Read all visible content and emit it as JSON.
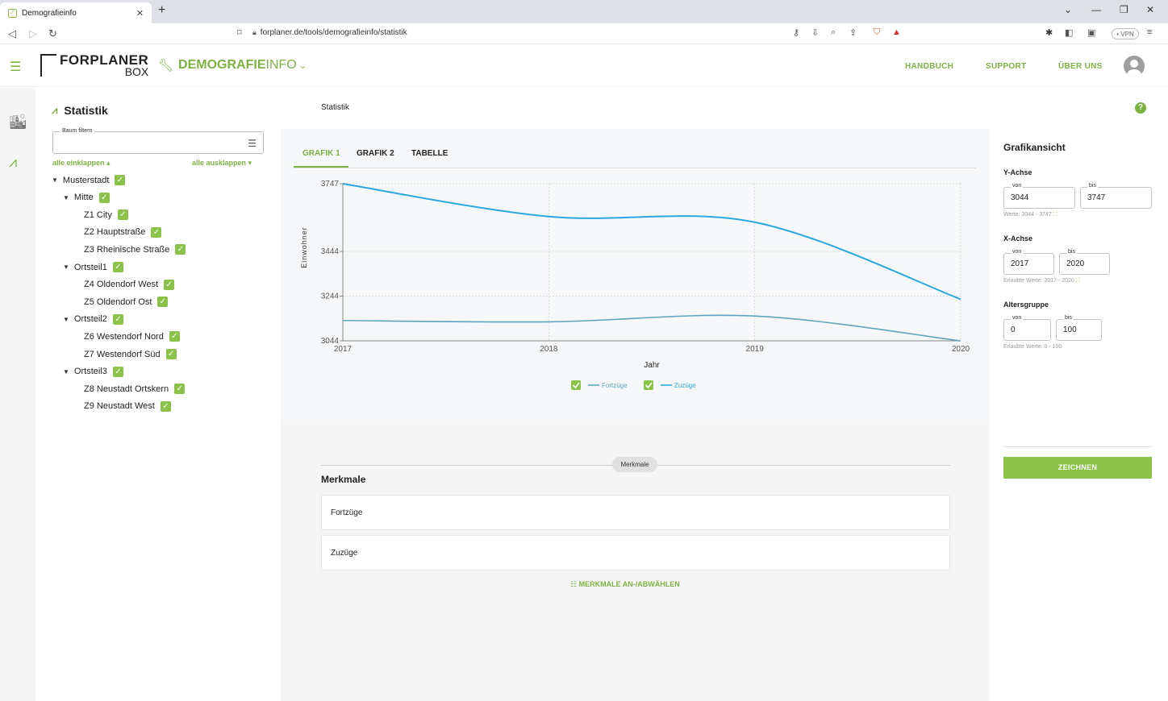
{
  "browser": {
    "tab_title": "Demografieinfo",
    "url": "forplaner.de/tools/demografieinfo/statistik",
    "vpn_label": "• VPN"
  },
  "header": {
    "logo_top": "FORPLANER",
    "logo_bottom": "BOX",
    "app_title_bold": "DEMOGRAFIE",
    "app_title_light": "INFO",
    "nav": [
      "HANDBUCH",
      "SUPPORT",
      "ÜBER UNS"
    ]
  },
  "sidebar": {
    "title": "Statistik",
    "filter_label": "Baum filtern",
    "collapse_all": "alle einklappen ▴",
    "expand_all": "alle ausklappen ▾",
    "tree": [
      {
        "label": "Musterstadt",
        "level": 0,
        "expandable": true,
        "checked": true
      },
      {
        "label": "Mitte",
        "level": 1,
        "expandable": true,
        "checked": true
      },
      {
        "label": "Z1 City",
        "level": 2,
        "expandable": false,
        "checked": true
      },
      {
        "label": "Z2 Hauptstraße",
        "level": 2,
        "expandable": false,
        "checked": true
      },
      {
        "label": "Z3 Rheinische Straße",
        "level": 2,
        "expandable": false,
        "checked": true
      },
      {
        "label": "Ortsteil1",
        "level": 1,
        "expandable": true,
        "checked": true
      },
      {
        "label": "Z4 Oldendorf West",
        "level": 2,
        "expandable": false,
        "checked": true
      },
      {
        "label": "Z5 Oldendorf Ost",
        "level": 2,
        "expandable": false,
        "checked": true
      },
      {
        "label": "Ortsteil2",
        "level": 1,
        "expandable": true,
        "checked": true
      },
      {
        "label": "Z6 Westendorf Nord",
        "level": 2,
        "expandable": false,
        "checked": true
      },
      {
        "label": "Z7 Westendorf Süd",
        "level": 2,
        "expandable": false,
        "checked": true
      },
      {
        "label": "Ortsteil3",
        "level": 1,
        "expandable": true,
        "checked": true
      },
      {
        "label": "Z8 Neustadt Ortskern",
        "level": 2,
        "expandable": false,
        "checked": true
      },
      {
        "label": "Z9 Neustadt West",
        "level": 2,
        "expandable": false,
        "checked": true
      }
    ]
  },
  "main": {
    "breadcrumb": "Statistik",
    "tabs": [
      "GRAFIK 1",
      "GRAFIK 2",
      "TABELLE"
    ],
    "merkmale_chip": "Merkmale",
    "merkmale_title": "Merkmale",
    "merkmale": [
      "Fortzüge",
      "Zuzüge"
    ],
    "toggle_label": "MERKMALE AN-/ABWÄHLEN"
  },
  "right": {
    "title": "Grafikansicht",
    "y_section": "Y-Achse",
    "y_from_label": "von",
    "y_from": "3044",
    "y_to_label": "bis",
    "y_to": "3747",
    "y_hint": "Werte: 3044 - 3747",
    "x_section": "X-Achse",
    "x_from_label": "von",
    "x_from": "2017",
    "x_to_label": "bis",
    "x_to": "2020",
    "x_hint": "Erlaubte Werte: 2017 - 2020",
    "age_section": "Altersgruppe",
    "age_from_label": "von",
    "age_from": "0",
    "age_to_label": "bis",
    "age_to": "100",
    "age_hint": "Erlaubte Werte: 0 - 100",
    "button": "ZEICHNEN"
  },
  "colors": {
    "accent": "#8bc34a",
    "zuzuege": "#29a8e0",
    "fortzuege": "#5aa6bd"
  },
  "chart_data": {
    "type": "line",
    "xlabel": "Jahr",
    "ylabel": "Einwohner",
    "x": [
      2017,
      2018,
      2019,
      2020
    ],
    "xlim": [
      2017,
      2020
    ],
    "ylim": [
      3044,
      3747
    ],
    "yticks": [
      3044,
      3244,
      3444,
      3747
    ],
    "grid": true,
    "legend_position": "bottom-center",
    "series": [
      {
        "name": "Fortzüge",
        "values": [
          3135,
          3129,
          3155,
          3044
        ]
      },
      {
        "name": "Zuzüge",
        "values": [
          3747,
          3600,
          3575,
          3230
        ]
      }
    ]
  }
}
